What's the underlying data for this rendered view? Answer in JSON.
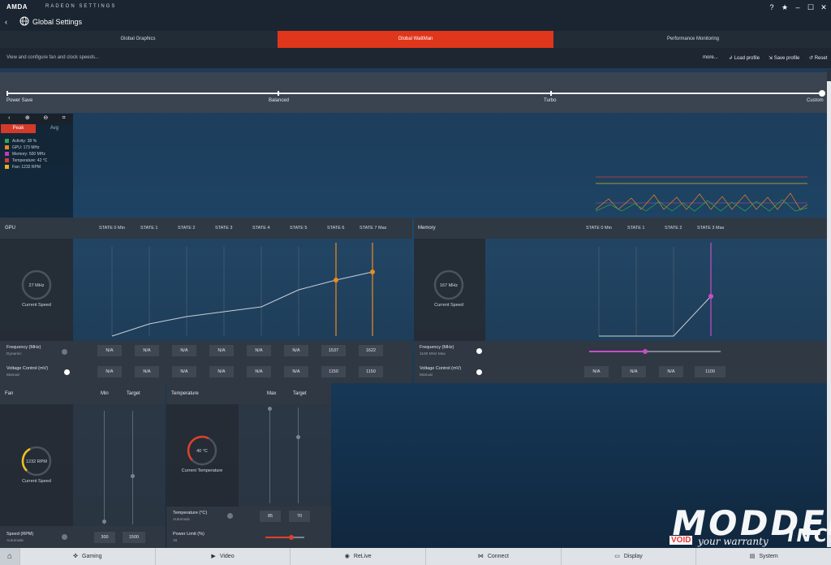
{
  "titlebar": {
    "brand": "AMDA",
    "app_name": "RADEON SETTINGS",
    "title": "Global Settings",
    "controls": [
      "?",
      "★",
      "–",
      "☐",
      "✕"
    ]
  },
  "tabs": [
    {
      "label": "Global Graphics",
      "active": false
    },
    {
      "label": "Global WattMan",
      "active": true
    },
    {
      "label": "Performance Monitoring",
      "active": false
    }
  ],
  "subbar": {
    "description": "View and configure fan and clock speeds...",
    "more": "more...",
    "load_profile": "Load profile",
    "save_profile": "Save profile",
    "reset": "Reset"
  },
  "profile_slider": {
    "labels": [
      "Power Save",
      "Balanced",
      "Turbo",
      "Custom"
    ],
    "selected": "Custom"
  },
  "chart_panel": {
    "peak": "Peak",
    "avg": "Avg",
    "legend": [
      {
        "label": "Activity: 38 %",
        "color": "#2fa84f"
      },
      {
        "label": "GPU: 173 MHz",
        "color": "#e8861e"
      },
      {
        "label": "Memory: 500 MHz",
        "color": "#b43fb9"
      },
      {
        "label": "Temperature: 42 °C",
        "color": "#d73b3b"
      },
      {
        "label": "Fan: 1232 RPM",
        "color": "#e3b51d"
      }
    ]
  },
  "gpu": {
    "title": "GPU",
    "states": [
      "STATE 0 Min",
      "STATE 1",
      "STATE 2",
      "STATE 3",
      "STATE 4",
      "STATE 5",
      "STATE 6",
      "STATE 7 Max"
    ],
    "gauge_value": "27 MHz",
    "gauge_label": "Current Speed",
    "frequency_label": "Frequency (MHz)",
    "frequency_mode": "Dynamic",
    "frequency_values": [
      "N/A",
      "N/A",
      "N/A",
      "N/A",
      "N/A",
      "N/A",
      "1537",
      "1622"
    ],
    "voltage_label": "Voltage Control (mV)",
    "voltage_mode": "Manual",
    "voltage_values": [
      "N/A",
      "N/A",
      "N/A",
      "N/A",
      "N/A",
      "N/A",
      "1150",
      "1150"
    ]
  },
  "memory": {
    "title": "Memory",
    "states": [
      "STATE 0 Min",
      "STATE 1",
      "STATE 2",
      "STATE 3 Max"
    ],
    "gauge_value": "167 MHz",
    "gauge_label": "Current Speed",
    "frequency_label": "Frequency (MHz)",
    "frequency_mode": "1100 MHz Max",
    "voltage_label": "Voltage Control (mV)",
    "voltage_mode": "Manual",
    "voltage_values": [
      "N/A",
      "N/A",
      "N/A",
      "1100"
    ]
  },
  "fan": {
    "title": "Fan",
    "col_min": "Min",
    "col_target": "Target",
    "gauge_value": "1232 RPM",
    "gauge_label": "Current Speed",
    "speed_label": "Speed (RPM)",
    "speed_mode": "Automatic",
    "speed_min": "300",
    "speed_target": "1500"
  },
  "temperature": {
    "title": "Temperature",
    "col_max": "Max",
    "col_target": "Target",
    "gauge_value": "40 °C",
    "gauge_label": "Current Temperature",
    "temp_label": "Temperature (°C)",
    "temp_mode": "Automatic",
    "temp_max": "85",
    "temp_target": "70",
    "power_label": "Power Limit (%)",
    "power_value": "15"
  },
  "bottom_nav": [
    "Gaming",
    "Video",
    "ReLive",
    "Connect",
    "Display",
    "System"
  ],
  "watermark": {
    "brand": "MODDERS",
    "inc": "INC.",
    "void": "VOID",
    "tagline": "your warranty"
  }
}
